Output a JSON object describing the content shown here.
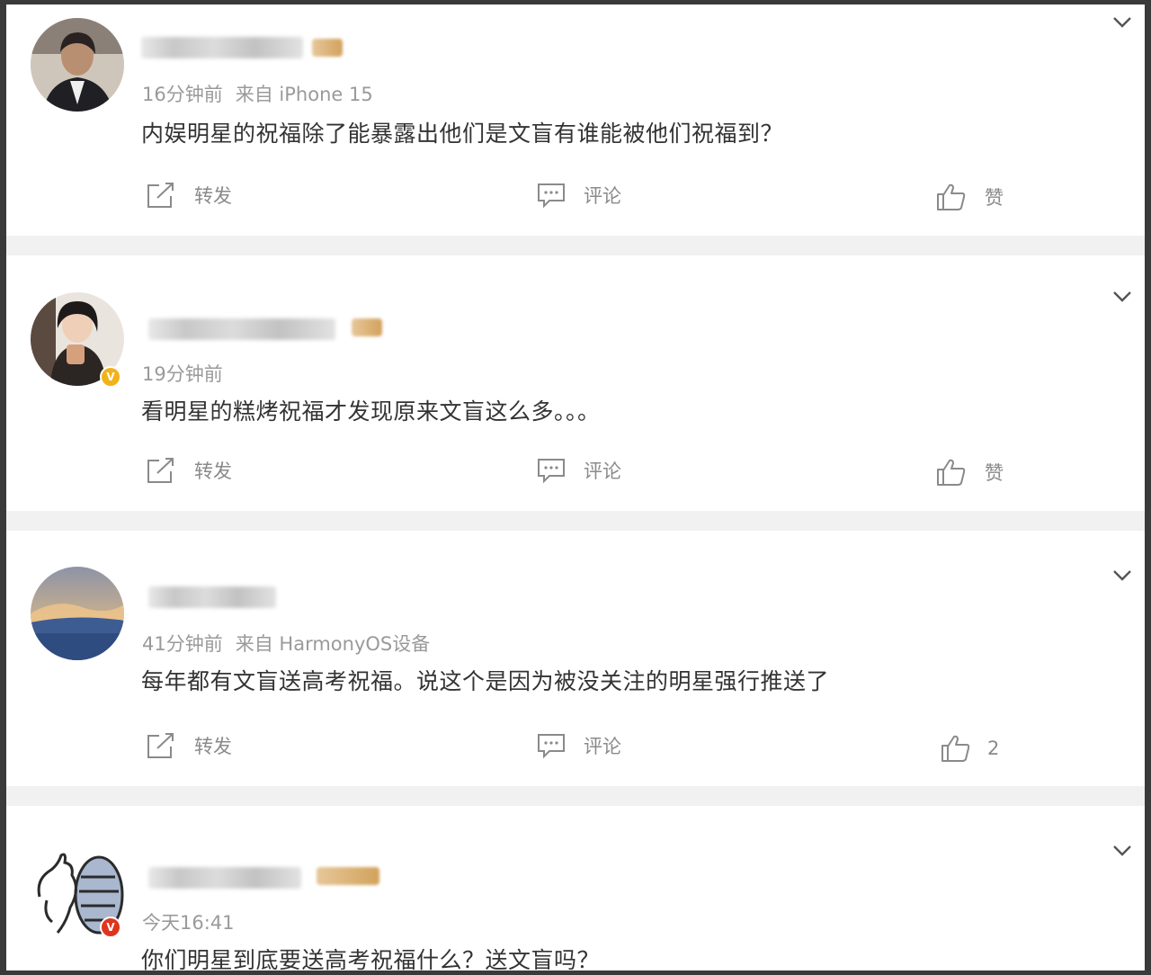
{
  "comments": [
    {
      "meta": [
        "16分钟前",
        "来自 iPhone 15"
      ],
      "text": "内娱明星的祝福除了能暴露出他们是文盲有谁能被他们祝福到？",
      "actions": {
        "repost": "转发",
        "comment": "评论",
        "like": "赞"
      }
    },
    {
      "meta": [
        "19分钟前"
      ],
      "text": "看明星的糕烤祝福才发现原来文盲这么多。。。",
      "actions": {
        "repost": "转发",
        "comment": "评论",
        "like": "赞"
      }
    },
    {
      "meta": [
        "41分钟前",
        "来自 HarmonyOS设备"
      ],
      "text": "每年都有文盲送高考祝福。说这个是因为被没关注的明星强行推送了",
      "actions": {
        "repost": "转发",
        "comment": "评论",
        "like": "2"
      }
    },
    {
      "meta": [
        "今天16:41"
      ],
      "text": "你们明星到底要送高考祝福什么？送文盲吗？"
    }
  ],
  "badges": {
    "verified_gold": "V",
    "verified_red": "V"
  },
  "icons": [
    "chevron-down-icon",
    "repost-icon",
    "comment-icon",
    "like-icon"
  ],
  "colors": {
    "text": "#333333",
    "meta": "#9a9a9a",
    "action": "#8a8a8a",
    "gold_badge": "#f1b21a",
    "red_badge": "#e0341e"
  }
}
